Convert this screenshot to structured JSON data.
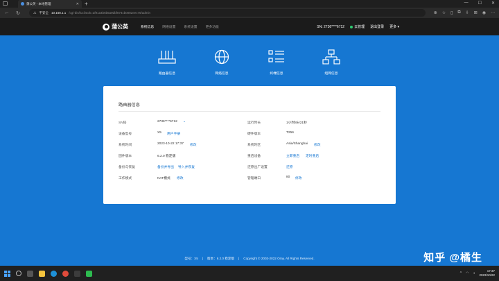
{
  "browser": {
    "tab_title": "蒲公英 - 本地管理",
    "insecure_label": "不安全",
    "url_host": "10.168.1.1",
    "url_path": "/cgi-bin/luci/stok=af91a4b6b5a9dbf874cb0082eec75/admin"
  },
  "nav": {
    "logo_text": "蒲公英",
    "links": [
      "系统信息",
      "网络设置",
      "系统设置",
      "更多功能"
    ],
    "sn_text": "SN: 2736****6712",
    "cloud_label": "云管理",
    "logout_label": "退出登录",
    "more_label": "更多 ▾"
  },
  "categories": [
    {
      "label": "路由器信息",
      "icon": "router-icon"
    },
    {
      "label": "网络信息",
      "icon": "globe-icon"
    },
    {
      "label": "终端信息",
      "icon": "list-icon"
    },
    {
      "label": "组网信息",
      "icon": "network-icon"
    }
  ],
  "card": {
    "title": "路由器信息",
    "left": [
      {
        "label": "SN码",
        "value": "2736****6712",
        "link": "⌄"
      },
      {
        "label": "设备型号",
        "value": "X5",
        "link": "用户手册"
      },
      {
        "label": "系统时间",
        "value": "2023-10-22 17:37",
        "link": "修改"
      },
      {
        "label": "固件版本",
        "value": "6.2.0 稳定版",
        "link": ""
      },
      {
        "label": "备份与恢复",
        "value": "",
        "link": "备份并导出",
        "link2": "导入并恢复"
      },
      {
        "label": "工作模式",
        "value": "NAT模式",
        "link": "修改"
      }
    ],
    "right": [
      {
        "label": "运行时长",
        "value": "1小时8分21秒",
        "link": ""
      },
      {
        "label": "硬件版本",
        "value": "T256",
        "link": ""
      },
      {
        "label": "系统时区",
        "value": "Asia/Shanghai",
        "link": "修改"
      },
      {
        "label": "重启设备",
        "value": "",
        "link": "立即重启",
        "link2": "定时重启"
      },
      {
        "label": "还原出厂设置",
        "value": "",
        "link": "还原"
      },
      {
        "label": "管理端口",
        "value": "80",
        "link": "修改"
      }
    ]
  },
  "footer": {
    "model": "型号：X5",
    "version": "版本：6.2.0 稳定版",
    "copyright": "Copyright © 2003-2022 Oray. All Rights Reserved."
  },
  "watermark": "知乎 @橘生",
  "taskbar": {
    "time": "17:37",
    "date": "2023/10/22"
  },
  "colors": {
    "page_bg": "#1677d2",
    "nav_bg": "#1b1b1b",
    "link": "#1677d2"
  }
}
